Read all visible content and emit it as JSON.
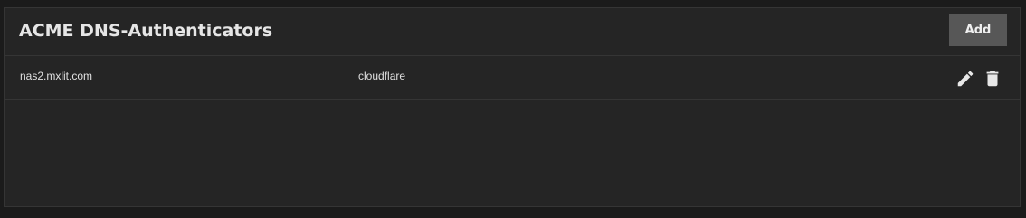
{
  "card": {
    "title": "ACME DNS-Authenticators",
    "add_label": "Add"
  },
  "rows": [
    {
      "name": "nas2.mxlit.com",
      "authenticator": "cloudflare",
      "actions": [
        "pencil-icon",
        "trash-icon"
      ]
    }
  ],
  "colors": {
    "background": "#1b1b1b",
    "card": "#252525",
    "button": "#575757",
    "text": "#e0e0e0"
  }
}
